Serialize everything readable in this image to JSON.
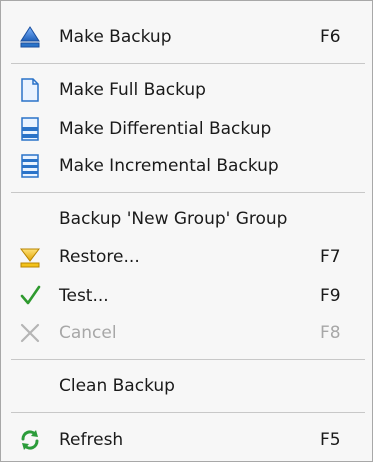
{
  "menu": {
    "items": [
      {
        "label": "Make Backup",
        "shortcut": "F6",
        "icon": "backup-triangle-icon"
      },
      {
        "label": "Make Full Backup",
        "shortcut": "",
        "icon": "full-backup-document-icon"
      },
      {
        "label": "Make Differential Backup",
        "shortcut": "",
        "icon": "differential-backup-icon"
      },
      {
        "label": "Make Incremental Backup",
        "shortcut": "",
        "icon": "incremental-backup-icon"
      },
      {
        "label": "Backup 'New Group' Group",
        "shortcut": ""
      },
      {
        "label": "Restore...",
        "shortcut": "F7",
        "icon": "restore-funnel-icon"
      },
      {
        "label": "Test...",
        "shortcut": "F9",
        "icon": "checkmark-icon"
      },
      {
        "label": "Cancel",
        "shortcut": "F8",
        "icon": "cancel-x-icon",
        "disabled": true
      },
      {
        "label": "Clean Backup",
        "shortcut": ""
      },
      {
        "label": "Refresh",
        "shortcut": "F5",
        "icon": "refresh-arrows-icon"
      }
    ]
  },
  "colors": {
    "accent_blue": "#2a73c8",
    "restore_yellow": "#f2c21a",
    "check_green": "#2f9a2f",
    "refresh_green": "#2b9c3a",
    "disabled_gray": "#a7a7a7"
  }
}
